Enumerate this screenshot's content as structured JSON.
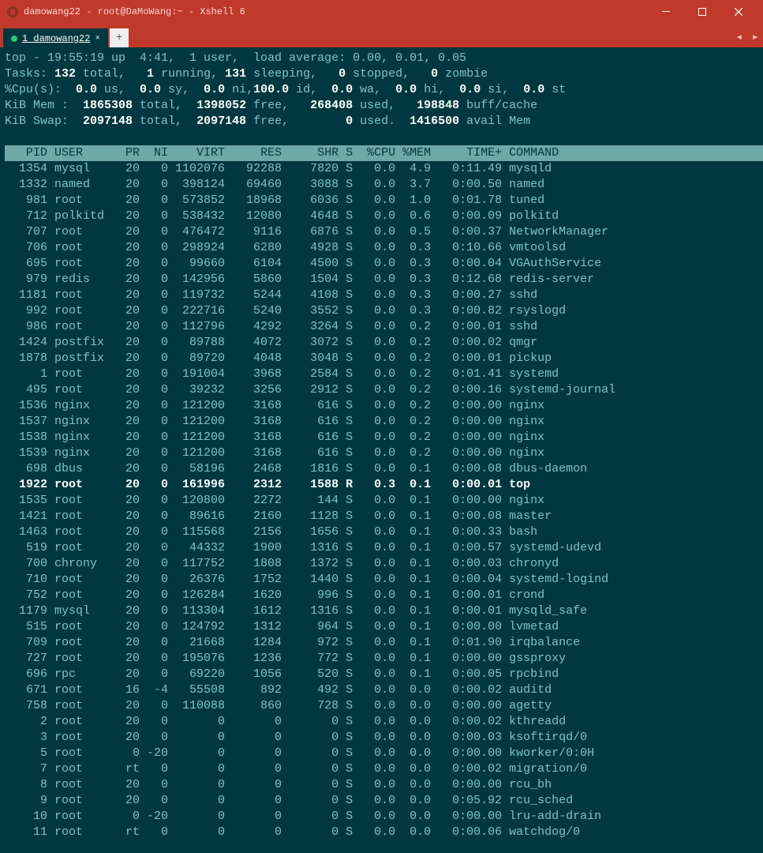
{
  "window": {
    "title": "damowang22 - root@DaMoWang:~ - Xshell 6"
  },
  "tab": {
    "label": "1 damowang22"
  },
  "summary": {
    "line1_a": "top - 19:55:19 up  4:41,  1 user,  load average: 0.00, 0.01, 0.05",
    "line2": "Tasks: <b>132</b> total,   <b>1</b> running, <b>131</b> sleeping,   <b>0</b> stopped,   <b>0</b> zombie",
    "line3": "%Cpu(s):  <b>0.0</b> us,  <b>0.0</b> sy,  <b>0.0</b> ni,<b>100.0</b> id,  <b>0.0</b> wa,  <b>0.0</b> hi,  <b>0.0</b> si,  <b>0.0</b> st",
    "line4": "KiB Mem :  <b>1865308</b> total,  <b>1398052</b> free,   <b>268408</b> used,   <b>198848</b> buff/cache",
    "line5": "KiB Swap:  <b>2097148</b> total,  <b>2097148</b> free,        <b>0</b> used.  <b>1416500</b> avail Mem"
  },
  "columns": [
    "PID",
    "USER",
    "PR",
    "NI",
    "VIRT",
    "RES",
    "SHR",
    "S",
    "%CPU",
    "%MEM",
    "TIME+",
    "COMMAND"
  ],
  "rows": [
    {
      "pid": 1354,
      "user": "mysql",
      "pr": "20",
      "ni": 0,
      "virt": 1102076,
      "res": 92288,
      "shr": 7820,
      "s": "S",
      "cpu": "0.0",
      "mem": "4.9",
      "time": "0:11.49",
      "cmd": "mysqld"
    },
    {
      "pid": 1332,
      "user": "named",
      "pr": "20",
      "ni": 0,
      "virt": 398124,
      "res": 69460,
      "shr": 3088,
      "s": "S",
      "cpu": "0.0",
      "mem": "3.7",
      "time": "0:00.50",
      "cmd": "named"
    },
    {
      "pid": 981,
      "user": "root",
      "pr": "20",
      "ni": 0,
      "virt": 573852,
      "res": 18968,
      "shr": 6036,
      "s": "S",
      "cpu": "0.0",
      "mem": "1.0",
      "time": "0:01.78",
      "cmd": "tuned"
    },
    {
      "pid": 712,
      "user": "polkitd",
      "pr": "20",
      "ni": 0,
      "virt": 538432,
      "res": 12080,
      "shr": 4648,
      "s": "S",
      "cpu": "0.0",
      "mem": "0.6",
      "time": "0:00.09",
      "cmd": "polkitd"
    },
    {
      "pid": 707,
      "user": "root",
      "pr": "20",
      "ni": 0,
      "virt": 476472,
      "res": 9116,
      "shr": 6876,
      "s": "S",
      "cpu": "0.0",
      "mem": "0.5",
      "time": "0:00.37",
      "cmd": "NetworkManager"
    },
    {
      "pid": 706,
      "user": "root",
      "pr": "20",
      "ni": 0,
      "virt": 298924,
      "res": 6280,
      "shr": 4928,
      "s": "S",
      "cpu": "0.0",
      "mem": "0.3",
      "time": "0:10.66",
      "cmd": "vmtoolsd"
    },
    {
      "pid": 695,
      "user": "root",
      "pr": "20",
      "ni": 0,
      "virt": 99660,
      "res": 6104,
      "shr": 4500,
      "s": "S",
      "cpu": "0.0",
      "mem": "0.3",
      "time": "0:00.04",
      "cmd": "VGAuthService"
    },
    {
      "pid": 979,
      "user": "redis",
      "pr": "20",
      "ni": 0,
      "virt": 142956,
      "res": 5860,
      "shr": 1504,
      "s": "S",
      "cpu": "0.0",
      "mem": "0.3",
      "time": "0:12.68",
      "cmd": "redis-server"
    },
    {
      "pid": 1181,
      "user": "root",
      "pr": "20",
      "ni": 0,
      "virt": 119732,
      "res": 5244,
      "shr": 4108,
      "s": "S",
      "cpu": "0.0",
      "mem": "0.3",
      "time": "0:00.27",
      "cmd": "sshd"
    },
    {
      "pid": 992,
      "user": "root",
      "pr": "20",
      "ni": 0,
      "virt": 222716,
      "res": 5240,
      "shr": 3552,
      "s": "S",
      "cpu": "0.0",
      "mem": "0.3",
      "time": "0:00.82",
      "cmd": "rsyslogd"
    },
    {
      "pid": 986,
      "user": "root",
      "pr": "20",
      "ni": 0,
      "virt": 112796,
      "res": 4292,
      "shr": 3264,
      "s": "S",
      "cpu": "0.0",
      "mem": "0.2",
      "time": "0:00.01",
      "cmd": "sshd"
    },
    {
      "pid": 1424,
      "user": "postfix",
      "pr": "20",
      "ni": 0,
      "virt": 89788,
      "res": 4072,
      "shr": 3072,
      "s": "S",
      "cpu": "0.0",
      "mem": "0.2",
      "time": "0:00.02",
      "cmd": "qmgr"
    },
    {
      "pid": 1878,
      "user": "postfix",
      "pr": "20",
      "ni": 0,
      "virt": 89720,
      "res": 4048,
      "shr": 3048,
      "s": "S",
      "cpu": "0.0",
      "mem": "0.2",
      "time": "0:00.01",
      "cmd": "pickup"
    },
    {
      "pid": 1,
      "user": "root",
      "pr": "20",
      "ni": 0,
      "virt": 191004,
      "res": 3968,
      "shr": 2584,
      "s": "S",
      "cpu": "0.0",
      "mem": "0.2",
      "time": "0:01.41",
      "cmd": "systemd"
    },
    {
      "pid": 495,
      "user": "root",
      "pr": "20",
      "ni": 0,
      "virt": 39232,
      "res": 3256,
      "shr": 2912,
      "s": "S",
      "cpu": "0.0",
      "mem": "0.2",
      "time": "0:00.16",
      "cmd": "systemd-journal"
    },
    {
      "pid": 1536,
      "user": "nginx",
      "pr": "20",
      "ni": 0,
      "virt": 121200,
      "res": 3168,
      "shr": 616,
      "s": "S",
      "cpu": "0.0",
      "mem": "0.2",
      "time": "0:00.00",
      "cmd": "nginx"
    },
    {
      "pid": 1537,
      "user": "nginx",
      "pr": "20",
      "ni": 0,
      "virt": 121200,
      "res": 3168,
      "shr": 616,
      "s": "S",
      "cpu": "0.0",
      "mem": "0.2",
      "time": "0:00.00",
      "cmd": "nginx"
    },
    {
      "pid": 1538,
      "user": "nginx",
      "pr": "20",
      "ni": 0,
      "virt": 121200,
      "res": 3168,
      "shr": 616,
      "s": "S",
      "cpu": "0.0",
      "mem": "0.2",
      "time": "0:00.00",
      "cmd": "nginx"
    },
    {
      "pid": 1539,
      "user": "nginx",
      "pr": "20",
      "ni": 0,
      "virt": 121200,
      "res": 3168,
      "shr": 616,
      "s": "S",
      "cpu": "0.0",
      "mem": "0.2",
      "time": "0:00.00",
      "cmd": "nginx"
    },
    {
      "pid": 698,
      "user": "dbus",
      "pr": "20",
      "ni": 0,
      "virt": 58196,
      "res": 2468,
      "shr": 1816,
      "s": "S",
      "cpu": "0.0",
      "mem": "0.1",
      "time": "0:00.08",
      "cmd": "dbus-daemon"
    },
    {
      "pid": 1922,
      "user": "root",
      "pr": "20",
      "ni": 0,
      "virt": 161996,
      "res": 2312,
      "shr": 1588,
      "s": "R",
      "cpu": "0.3",
      "mem": "0.1",
      "time": "0:00.01",
      "cmd": "top",
      "bold": true
    },
    {
      "pid": 1535,
      "user": "root",
      "pr": "20",
      "ni": 0,
      "virt": 120800,
      "res": 2272,
      "shr": 144,
      "s": "S",
      "cpu": "0.0",
      "mem": "0.1",
      "time": "0:00.00",
      "cmd": "nginx"
    },
    {
      "pid": 1421,
      "user": "root",
      "pr": "20",
      "ni": 0,
      "virt": 89616,
      "res": 2160,
      "shr": 1128,
      "s": "S",
      "cpu": "0.0",
      "mem": "0.1",
      "time": "0:00.08",
      "cmd": "master"
    },
    {
      "pid": 1463,
      "user": "root",
      "pr": "20",
      "ni": 0,
      "virt": 115568,
      "res": 2156,
      "shr": 1656,
      "s": "S",
      "cpu": "0.0",
      "mem": "0.1",
      "time": "0:00.33",
      "cmd": "bash"
    },
    {
      "pid": 519,
      "user": "root",
      "pr": "20",
      "ni": 0,
      "virt": 44332,
      "res": 1900,
      "shr": 1316,
      "s": "S",
      "cpu": "0.0",
      "mem": "0.1",
      "time": "0:00.57",
      "cmd": "systemd-udevd"
    },
    {
      "pid": 700,
      "user": "chrony",
      "pr": "20",
      "ni": 0,
      "virt": 117752,
      "res": 1808,
      "shr": 1372,
      "s": "S",
      "cpu": "0.0",
      "mem": "0.1",
      "time": "0:00.03",
      "cmd": "chronyd"
    },
    {
      "pid": 710,
      "user": "root",
      "pr": "20",
      "ni": 0,
      "virt": 26376,
      "res": 1752,
      "shr": 1440,
      "s": "S",
      "cpu": "0.0",
      "mem": "0.1",
      "time": "0:00.04",
      "cmd": "systemd-logind"
    },
    {
      "pid": 752,
      "user": "root",
      "pr": "20",
      "ni": 0,
      "virt": 126284,
      "res": 1620,
      "shr": 996,
      "s": "S",
      "cpu": "0.0",
      "mem": "0.1",
      "time": "0:00.01",
      "cmd": "crond"
    },
    {
      "pid": 1179,
      "user": "mysql",
      "pr": "20",
      "ni": 0,
      "virt": 113304,
      "res": 1612,
      "shr": 1316,
      "s": "S",
      "cpu": "0.0",
      "mem": "0.1",
      "time": "0:00.01",
      "cmd": "mysqld_safe"
    },
    {
      "pid": 515,
      "user": "root",
      "pr": "20",
      "ni": 0,
      "virt": 124792,
      "res": 1312,
      "shr": 964,
      "s": "S",
      "cpu": "0.0",
      "mem": "0.1",
      "time": "0:00.00",
      "cmd": "lvmetad"
    },
    {
      "pid": 709,
      "user": "root",
      "pr": "20",
      "ni": 0,
      "virt": 21668,
      "res": 1284,
      "shr": 972,
      "s": "S",
      "cpu": "0.0",
      "mem": "0.1",
      "time": "0:01.90",
      "cmd": "irqbalance"
    },
    {
      "pid": 727,
      "user": "root",
      "pr": "20",
      "ni": 0,
      "virt": 195076,
      "res": 1236,
      "shr": 772,
      "s": "S",
      "cpu": "0.0",
      "mem": "0.1",
      "time": "0:00.00",
      "cmd": "gssproxy"
    },
    {
      "pid": 696,
      "user": "rpc",
      "pr": "20",
      "ni": 0,
      "virt": 69220,
      "res": 1056,
      "shr": 520,
      "s": "S",
      "cpu": "0.0",
      "mem": "0.1",
      "time": "0:00.05",
      "cmd": "rpcbind"
    },
    {
      "pid": 671,
      "user": "root",
      "pr": "16",
      "ni": -4,
      "virt": 55508,
      "res": 892,
      "shr": 492,
      "s": "S",
      "cpu": "0.0",
      "mem": "0.0",
      "time": "0:00.02",
      "cmd": "auditd"
    },
    {
      "pid": 758,
      "user": "root",
      "pr": "20",
      "ni": 0,
      "virt": 110088,
      "res": 860,
      "shr": 728,
      "s": "S",
      "cpu": "0.0",
      "mem": "0.0",
      "time": "0:00.00",
      "cmd": "agetty"
    },
    {
      "pid": 2,
      "user": "root",
      "pr": "20",
      "ni": 0,
      "virt": 0,
      "res": 0,
      "shr": 0,
      "s": "S",
      "cpu": "0.0",
      "mem": "0.0",
      "time": "0:00.02",
      "cmd": "kthreadd"
    },
    {
      "pid": 3,
      "user": "root",
      "pr": "20",
      "ni": 0,
      "virt": 0,
      "res": 0,
      "shr": 0,
      "s": "S",
      "cpu": "0.0",
      "mem": "0.0",
      "time": "0:00.03",
      "cmd": "ksoftirqd/0"
    },
    {
      "pid": 5,
      "user": "root",
      "pr": "0",
      "ni": -20,
      "virt": 0,
      "res": 0,
      "shr": 0,
      "s": "S",
      "cpu": "0.0",
      "mem": "0.0",
      "time": "0:00.00",
      "cmd": "kworker/0:0H"
    },
    {
      "pid": 7,
      "user": "root",
      "pr": "rt",
      "ni": 0,
      "virt": 0,
      "res": 0,
      "shr": 0,
      "s": "S",
      "cpu": "0.0",
      "mem": "0.0",
      "time": "0:00.02",
      "cmd": "migration/0"
    },
    {
      "pid": 8,
      "user": "root",
      "pr": "20",
      "ni": 0,
      "virt": 0,
      "res": 0,
      "shr": 0,
      "s": "S",
      "cpu": "0.0",
      "mem": "0.0",
      "time": "0:00.00",
      "cmd": "rcu_bh"
    },
    {
      "pid": 9,
      "user": "root",
      "pr": "20",
      "ni": 0,
      "virt": 0,
      "res": 0,
      "shr": 0,
      "s": "S",
      "cpu": "0.0",
      "mem": "0.0",
      "time": "0:05.92",
      "cmd": "rcu_sched"
    },
    {
      "pid": 10,
      "user": "root",
      "pr": "0",
      "ni": -20,
      "virt": 0,
      "res": 0,
      "shr": 0,
      "s": "S",
      "cpu": "0.0",
      "mem": "0.0",
      "time": "0:00.00",
      "cmd": "lru-add-drain"
    },
    {
      "pid": 11,
      "user": "root",
      "pr": "rt",
      "ni": 0,
      "virt": 0,
      "res": 0,
      "shr": 0,
      "s": "S",
      "cpu": "0.0",
      "mem": "0.0",
      "time": "0:00.06",
      "cmd": "watchdog/0"
    }
  ]
}
